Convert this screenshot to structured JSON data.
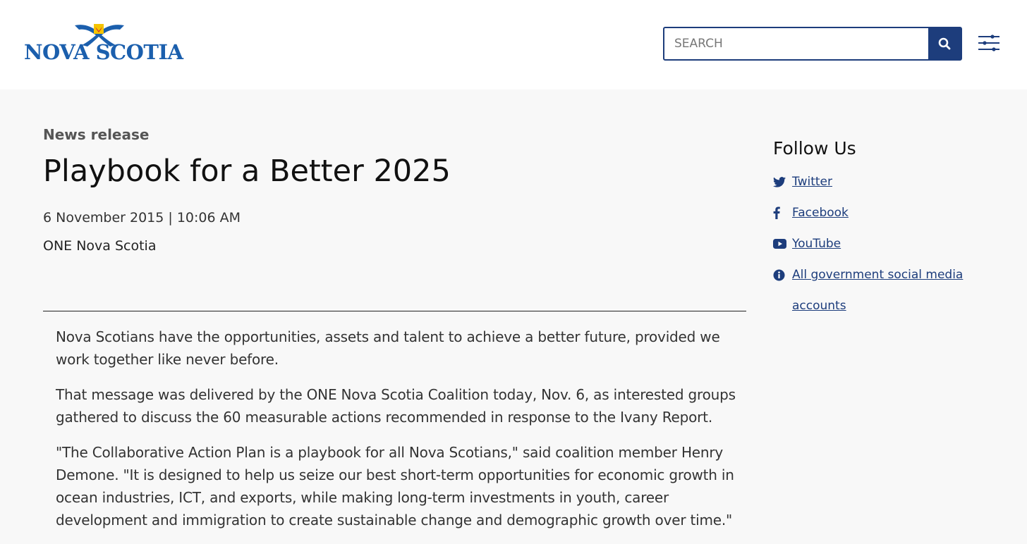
{
  "header": {
    "logo_text": "NOVA SCOTIA",
    "search": {
      "placeholder": "SEARCH"
    }
  },
  "article": {
    "kicker": "News release",
    "title": "Playbook for a Better 2025",
    "dateline": "6 November 2015 | 10:06 AM",
    "source": "ONE Nova Scotia",
    "paragraphs": [
      "Nova Scotians have the opportunities, assets and talent to achieve a better future, provided we work together like never before.",
      "That message was delivered by the ONE Nova Scotia Coalition today, Nov. 6, as interested groups gathered to discuss the 60 measurable actions recommended in response to the Ivany Report.",
      "\"The Collaborative Action Plan is a playbook for all Nova Scotians,\" said coalition member Henry Demone. \"It is designed to help us seize our best short-term opportunities for economic growth in ocean industries, ICT, and exports, while making long-term investments in youth, career development and immigration to create sustainable change and demographic growth over time.\""
    ]
  },
  "aside": {
    "heading": "Follow Us",
    "links": [
      {
        "label": "Twitter",
        "icon": "twitter-icon"
      },
      {
        "label": "Facebook",
        "icon": "facebook-icon"
      },
      {
        "label": "YouTube",
        "icon": "youtube-icon"
      },
      {
        "label": "All government social media accounts",
        "icon": "info-icon"
      }
    ]
  },
  "colors": {
    "brand_blue": "#1b5fad",
    "nav_navy": "#1d3d7c",
    "background": "#f8f8f8"
  }
}
